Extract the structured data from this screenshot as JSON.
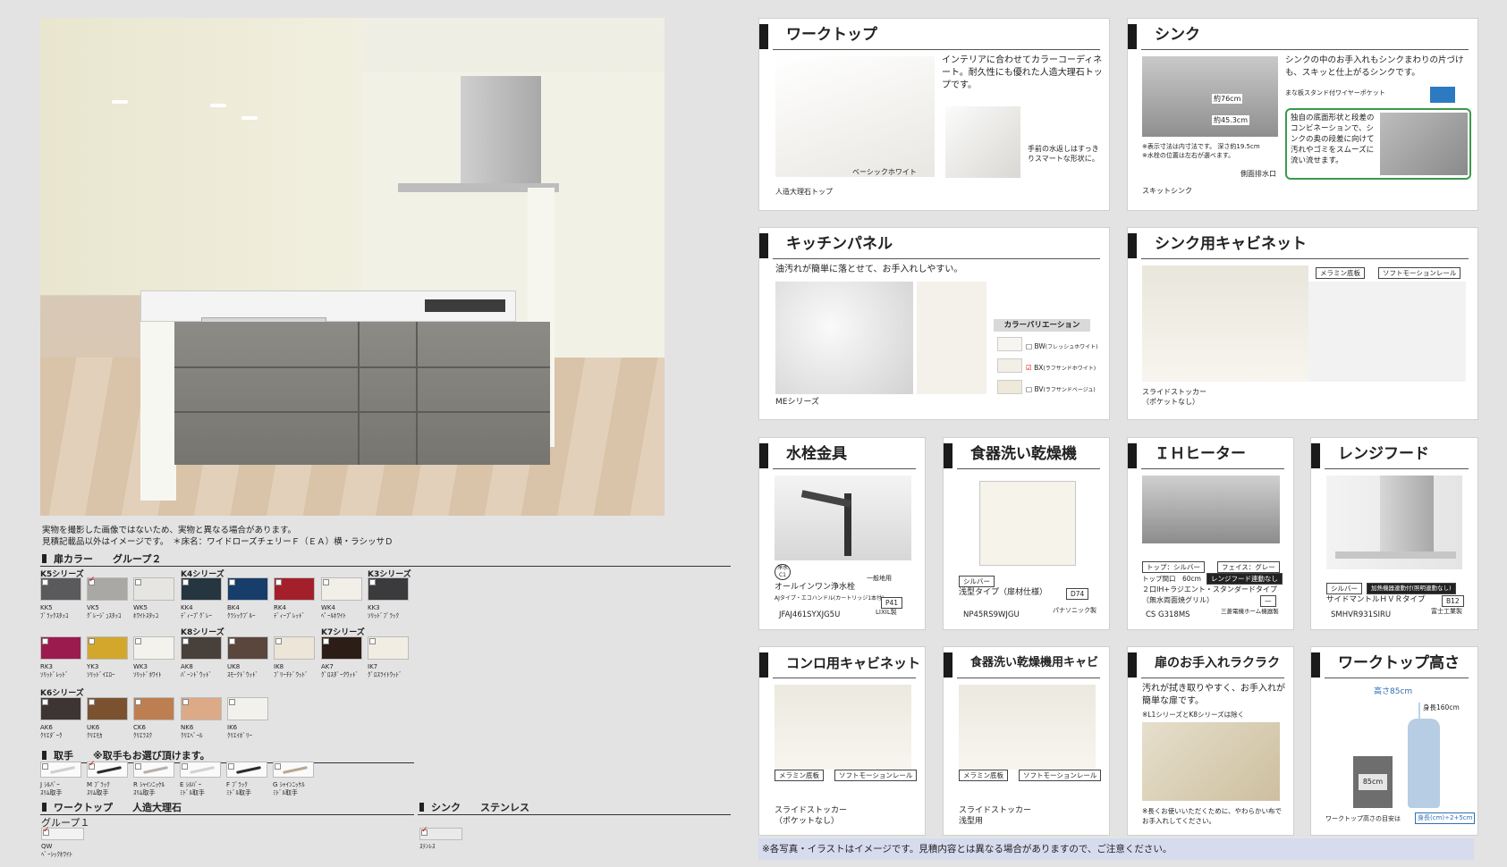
{
  "hero": {
    "caption1": "実物を撮影した画像ではないため、実物と異なる場合があります。",
    "caption2": "見積記載品以外はイメージです。　＊床名：ワイドローズチェリーＦ（ＥＡ）横・ラシッサＤ"
  },
  "door_color": {
    "heading": "扉カラー　　グループ２",
    "series": [
      "K5シリーズ",
      "K4シリーズ",
      "K3シリーズ",
      "K8シリーズ",
      "K7シリーズ",
      "K6シリーズ"
    ],
    "swatches": [
      {
        "code": "KK5",
        "name": "ﾌﾞﾗｯｸｽﾀｯｺ",
        "color": "#5a5a5c",
        "checked": false
      },
      {
        "code": "VK5",
        "name": "ｸﾞﾚｰｼﾞｭｽﾀｯｺ",
        "color": "#a9a8a4",
        "checked": true
      },
      {
        "code": "WK5",
        "name": "ﾎﾜｲﾄｽﾀｯｺ",
        "color": "#e6e5e1",
        "checked": false
      },
      {
        "code": "KK4",
        "name": "ﾃﾞｨｰﾌﾟｸﾞﾚｰ",
        "color": "#263640",
        "checked": false
      },
      {
        "code": "BK4",
        "name": "ｸﾗｼｯｸﾌﾞﾙｰ",
        "color": "#173d6b",
        "checked": false
      },
      {
        "code": "RK4",
        "name": "ﾃﾞｨｰﾌﾟﾚｯﾄﾞ",
        "color": "#a3202a",
        "checked": false
      },
      {
        "code": "WK4",
        "name": "ﾍﾟｰﾙﾎﾜｲﾄ",
        "color": "#f2efe9",
        "checked": false
      },
      {
        "code": "KK3",
        "name": "ｿﾘｯﾄﾞﾌﾞﾗｯｸ",
        "color": "#3b3b3d",
        "checked": false
      },
      {
        "code": "RK3",
        "name": "ｿﾘｯﾄﾞﾚｯﾄﾞ",
        "color": "#9c1b4e",
        "checked": false
      },
      {
        "code": "YK3",
        "name": "ｿﾘｯﾄﾞｲｴﾛｰ",
        "color": "#d3a72c",
        "checked": false
      },
      {
        "code": "WK3",
        "name": "ｿﾘｯﾄﾞﾎﾜｲﾄ",
        "color": "#f4f2ec",
        "checked": false
      },
      {
        "code": "AK8",
        "name": "ﾊﾞｰﾝﾄﾞｳｯﾄﾞ",
        "color": "#48403b",
        "checked": false
      },
      {
        "code": "UK8",
        "name": "ｽﾓｰｸﾄﾞｳｯﾄﾞ",
        "color": "#5a463c",
        "checked": false
      },
      {
        "code": "IK8",
        "name": "ﾌﾞﾘｰﾁﾄﾞｳｯﾄﾞ",
        "color": "#ece5d8",
        "checked": false
      },
      {
        "code": "AK7",
        "name": "ｸﾞﾛｽﾀﾞｰｸｳｯﾄﾞ",
        "color": "#2c1e17",
        "checked": false
      },
      {
        "code": "IK7",
        "name": "ｸﾞﾛｽﾗｲﾄｳｯﾄﾞ",
        "color": "#f1ede3",
        "checked": false
      },
      {
        "code": "AK6",
        "name": "ｸﾘｴﾀﾞｰｸ",
        "color": "#3d3533",
        "checked": false
      },
      {
        "code": "UK6",
        "name": "ｸﾘｴﾓｶ",
        "color": "#7a5230",
        "checked": false
      },
      {
        "code": "CK6",
        "name": "ｸﾘｴﾗｽｸ",
        "color": "#bd7f51",
        "checked": false
      },
      {
        "code": "NK6",
        "name": "ｸﾘｴﾍﾞｰﾙ",
        "color": "#dcaa86",
        "checked": false
      },
      {
        "code": "IK6",
        "name": "ｸﾘｴｲﾎﾞﾘｰ",
        "color": "#f2f1ec",
        "checked": false
      }
    ]
  },
  "handle": {
    "heading": "取手　　※取手もお選び頂けます。",
    "items": [
      {
        "code": "J ｼﾙﾊﾞｰ",
        "name": "ｽﾘﾑ取手",
        "color": "#cfcfcf",
        "checked": false
      },
      {
        "code": "M ﾌﾞﾗｯｸ",
        "name": "ｽﾘﾑ取手",
        "color": "#2b2b2b",
        "checked": true
      },
      {
        "code": "R ｼｬｲﾝﾆｯｹﾙ",
        "name": "ｽﾘﾑ取手",
        "color": "#b5b0a7",
        "checked": false
      },
      {
        "code": "E ｼﾙﾊﾞｰ",
        "name": "ﾐﾄﾞﾙ取手",
        "color": "#d2d2d2",
        "checked": false
      },
      {
        "code": "F ﾌﾞﾗｯｸ",
        "name": "ﾐﾄﾞﾙ取手",
        "color": "#2b2b2b",
        "checked": false
      },
      {
        "code": "G ｼｬｲﾝﾆｯｹﾙ",
        "name": "ﾐﾄﾞﾙ取手",
        "color": "#b8a88e",
        "checked": false
      }
    ]
  },
  "worktop_sel": {
    "heading": "ワークトップ　　人造大理石",
    "group": "グループ１",
    "code": "QW",
    "name": "ﾍﾞｰｼｯｸﾎﾜｲﾄ"
  },
  "sink_sel": {
    "heading": "シンク　　ステンレス",
    "name": "ｽﾃﾝﾚｽ"
  },
  "cards": {
    "worktop": {
      "title": "ワークトップ",
      "desc": "インテリアに合わせてカラーコーディネート。耐久性にも優れた人造大理石トップです。",
      "color": "ベーシックホワイト",
      "edge": "手前の水返しはすっきりスマートな形状に。",
      "product": "人造大理石トップ"
    },
    "sink": {
      "title": "シンク",
      "desc": "シンクの中のお手入れもシンクまわりの片づけも、スキッと仕上がるシンクです。",
      "pocket": "まな板スタンド付ワイヤーポケット",
      "dim1": "約76cm",
      "dim2": "約45.3cm",
      "note1": "※表示寸法は内寸法です。 深さ約19.5cm",
      "note2": "※水栓の位置は左右が選べます。",
      "drain": "側面排水口",
      "feature": "独自の底面形状と段差のコンビネーションで、シンクの奥の段差に向けて汚れやゴミをスムーズに流い流せます。",
      "product": "スキットシンク"
    },
    "panel": {
      "title": "キッチンパネル",
      "desc": "油汚れが簡単に落とせて、お手入れしやすい。",
      "variation": "カラーバリエーション",
      "opt1": "BW",
      "opt1_name": "(フレッシュホワイト)",
      "opt2": "BX",
      "opt2_name": "(ラフサンドホワイト)",
      "opt3": "BV",
      "opt3_name": "(ラフサンドベージュ)",
      "series": "MEシリーズ"
    },
    "sink_cab": {
      "title": "シンク用キャビネット",
      "tag1": "メラミン底板",
      "tag2": "ソフトモーションレール",
      "name": "スライドストッカー",
      "sub": "（ポケットなし）"
    },
    "faucet": {
      "title": "水栓金具",
      "badge": "浄水C1",
      "kind": "一般地用",
      "name": "オールインワン浄水栓",
      "sub": "AJタイプ・エコハンドル(カートリッジ1本付)",
      "spec": "P41",
      "maker": "LIXIL製",
      "model": "JFAJ461SYXJG5U"
    },
    "dish": {
      "title": "食器洗い乾燥機",
      "color": "シルバー",
      "name": "浅型タイプ（扉材仕様）",
      "spec": "D74",
      "maker": "パナソニック製",
      "model": "NP45RS9WJGU"
    },
    "ih": {
      "title": "ＩＨヒーター",
      "top": "トップ：シルバー",
      "face": "フェイス：グレー",
      "width": "トップ間口　60cm",
      "link": "レンジフード連動なし",
      "name": "２口IH+ラジエント・スタンダードタイプ",
      "sub": "（無水両面焼グリル）",
      "spec": "—",
      "maker": "三菱電機ホーム機器製",
      "model": "CS G318MS"
    },
    "hood": {
      "title": "レンジフード",
      "color": "シルバー",
      "link": "加熱機器連動付(照明連動なし)",
      "name": "サイドマントルＨＶＲタイプ",
      "spec": "B12",
      "maker": "富士工業製",
      "model": "SMHVR931SIRU"
    },
    "stove_cab": {
      "title": "コンロ用キャビネット",
      "tag1": "メラミン底板",
      "tag2": "ソフトモーションレール",
      "name": "スライドストッカー",
      "sub": "（ポケットなし）"
    },
    "dish_cab": {
      "title": "食器洗い乾燥機用キャビネット",
      "tag1": "メラミン底板",
      "tag2": "ソフトモーションレール",
      "name": "スライドストッカー",
      "sub": "浅型用"
    },
    "door_care": {
      "title": "扉のお手入れラクラク",
      "desc": "汚れが拭き取りやすく、お手入れが簡単な扉です。",
      "note": "※L1シリーズとK8シリーズは除く",
      "foot": "※長くお使いいただくために、やわらかい布でお手入れしてください。"
    },
    "height": {
      "title": "ワークトップ高さ",
      "height": "高さ85cm",
      "person": "身長160cm",
      "box": "85cm",
      "foot": "ワークトップ高さの目安は",
      "formula": "身長(cm)÷2+5cm"
    }
  },
  "footer": "※各写真・イラストはイメージです。見積内容とは異なる場合がありますので、ご注意ください。"
}
